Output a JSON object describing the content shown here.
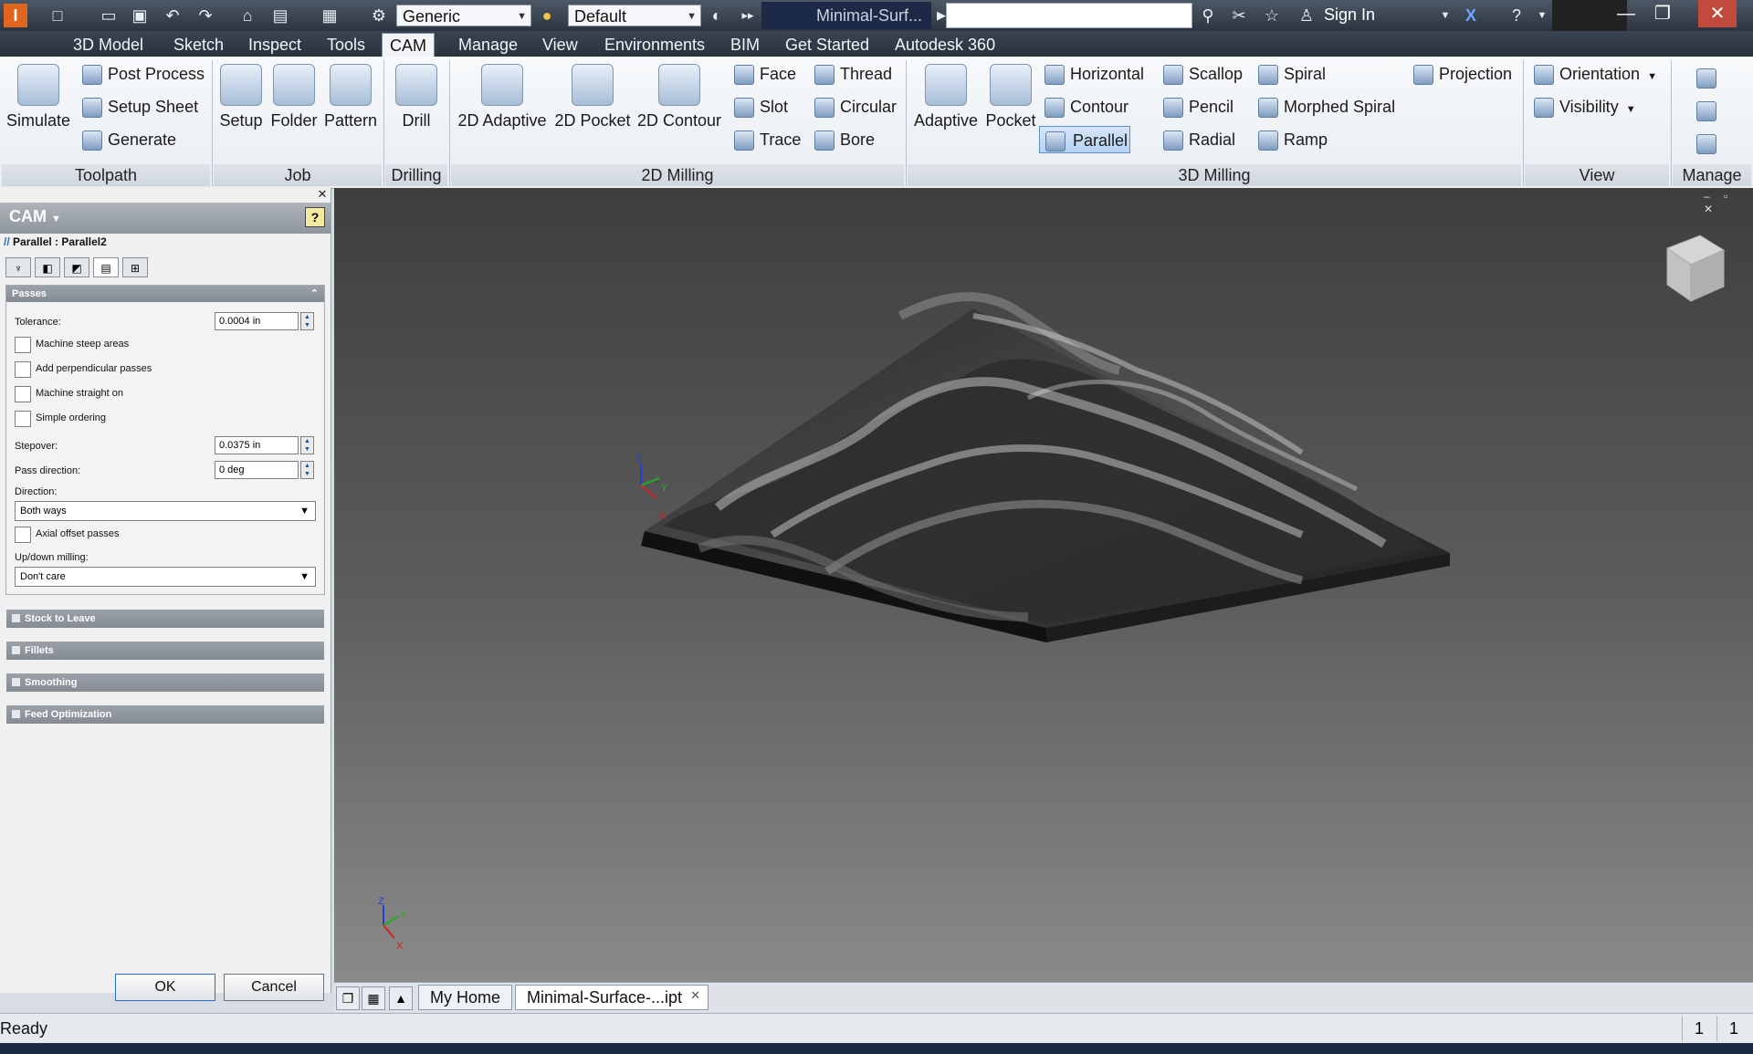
{
  "quick_access": {
    "material_select": "Generic",
    "appearance_select": "Default",
    "doc_title": "Minimal-Surf...",
    "sign_in": "Sign In"
  },
  "tabs": [
    "3D Model",
    "Sketch",
    "Inspect",
    "Tools",
    "CAM",
    "Manage",
    "View",
    "Environments",
    "BIM",
    "Get Started",
    "Autodesk 360"
  ],
  "active_tab": "CAM",
  "ribbon": {
    "toolpath": {
      "label": "Toolpath",
      "simulate": "Simulate",
      "post_process": "Post Process",
      "setup_sheet": "Setup Sheet",
      "generate": "Generate"
    },
    "job": {
      "label": "Job",
      "setup": "Setup",
      "folder": "Folder",
      "pattern": "Pattern"
    },
    "drilling": {
      "label": "Drilling",
      "drill": "Drill"
    },
    "milling2d": {
      "label": "2D Milling",
      "adaptive": "2D Adaptive",
      "pocket": "2D Pocket",
      "contour": "2D Contour",
      "face": "Face",
      "slot": "Slot",
      "trace": "Trace",
      "thread": "Thread",
      "circular": "Circular",
      "bore": "Bore"
    },
    "milling3d": {
      "label": "3D Milling",
      "adaptive": "Adaptive",
      "pocket": "Pocket",
      "horizontal": "Horizontal",
      "contour": "Contour",
      "parallel": "Parallel",
      "scallop": "Scallop",
      "pencil": "Pencil",
      "radial": "Radial",
      "spiral": "Spiral",
      "morphed_spiral": "Morphed Spiral",
      "ramp": "Ramp",
      "projection": "Projection"
    },
    "view": {
      "label": "View",
      "orientation": "Orientation",
      "visibility": "Visibility"
    },
    "manage": {
      "label": "Manage"
    }
  },
  "cam_panel": {
    "title": "CAM",
    "operation": "Parallel : Parallel2",
    "passes": {
      "header": "Passes",
      "tolerance_label": "Tolerance:",
      "tolerance_value": "0.0004 in",
      "machine_steep": "Machine steep areas",
      "add_perpendicular": "Add perpendicular passes",
      "machine_straight": "Machine straight on",
      "simple_ordering": "Simple ordering",
      "stepover_label": "Stepover:",
      "stepover_value": "0.0375 in",
      "pass_direction_label": "Pass direction:",
      "pass_direction_value": "0 deg",
      "direction_label": "Direction:",
      "direction_value": "Both ways",
      "axial_offset": "Axial offset passes",
      "updown_label": "Up/down milling:",
      "updown_value": "Don't care"
    },
    "sections": [
      "Stock to Leave",
      "Fillets",
      "Smoothing",
      "Feed Optimization"
    ],
    "ok": "OK",
    "cancel": "Cancel"
  },
  "doc_tabs": {
    "home": "My Home",
    "file": "Minimal-Surface-...ipt"
  },
  "status": {
    "text": "Ready",
    "n1": "1",
    "n2": "1"
  },
  "axes": {
    "x": "X",
    "y": "Y",
    "z": "Z"
  },
  "colors": {
    "accent": "#2b6cc4",
    "ribbon_tab_bg": "#2a323d",
    "x_axis": "#d42020",
    "y_axis": "#20b020",
    "z_axis": "#2040d0"
  }
}
